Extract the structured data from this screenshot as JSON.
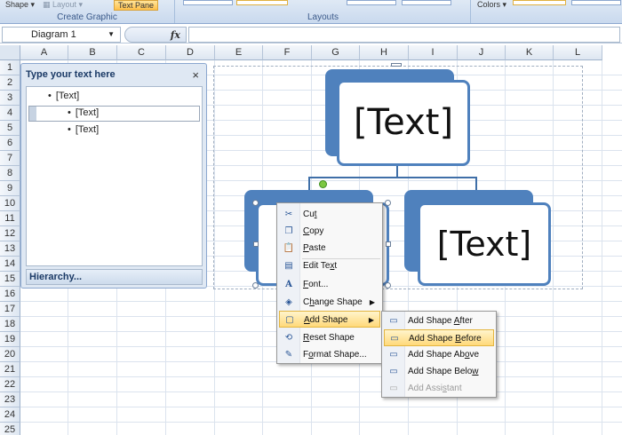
{
  "ribbon": {
    "shape_btn": "Shape",
    "layout_btn": "Layout",
    "text_pane_btn": "Text Pane",
    "group_create": "Create Graphic",
    "group_layouts": "Layouts",
    "colors_btn": "Colors"
  },
  "formula_bar": {
    "name_box": "Diagram 1",
    "fx": "fx"
  },
  "columns": [
    "A",
    "B",
    "C",
    "D",
    "E",
    "F",
    "G",
    "H",
    "I",
    "J",
    "K",
    "L"
  ],
  "rows": [
    "1",
    "2",
    "3",
    "4",
    "5",
    "6",
    "7",
    "8",
    "9",
    "10",
    "11",
    "12",
    "13",
    "14",
    "15",
    "16",
    "17",
    "18",
    "19",
    "20",
    "21",
    "22",
    "23",
    "24",
    "25"
  ],
  "text_pane": {
    "title": "Type your text here",
    "close": "×",
    "items": [
      "[Text]",
      "[Text]",
      "[Text]"
    ],
    "footer": "Hierarchy..."
  },
  "diagram": {
    "top_text": "[Text]",
    "right_text": "[Text]"
  },
  "context_menu": {
    "items": [
      {
        "label": "Cut",
        "icon": "scissors-icon"
      },
      {
        "label": "Copy",
        "icon": "copy-icon"
      },
      {
        "label": "Paste",
        "icon": "paste-icon"
      },
      {
        "label": "Edit Text",
        "icon": "edit-text-icon"
      },
      {
        "label": "Font...",
        "icon": "font-icon"
      },
      {
        "label": "Change Shape",
        "icon": "change-shape-icon"
      },
      {
        "label": "Add Shape",
        "icon": "add-shape-icon"
      },
      {
        "label": "Reset Shape",
        "icon": "reset-shape-icon"
      },
      {
        "label": "Format Shape...",
        "icon": "format-shape-icon"
      }
    ]
  },
  "submenu": {
    "items": [
      {
        "label": "Add Shape After",
        "icon": "shape-after-icon"
      },
      {
        "label": "Add Shape Before",
        "icon": "shape-before-icon"
      },
      {
        "label": "Add Shape Above",
        "icon": "shape-above-icon"
      },
      {
        "label": "Add Shape Below",
        "icon": "shape-below-icon"
      },
      {
        "label": "Add Assistant",
        "icon": "assistant-icon"
      }
    ]
  },
  "colors": {
    "accent": "#4f81bd",
    "highlight": "#ffd97a"
  }
}
